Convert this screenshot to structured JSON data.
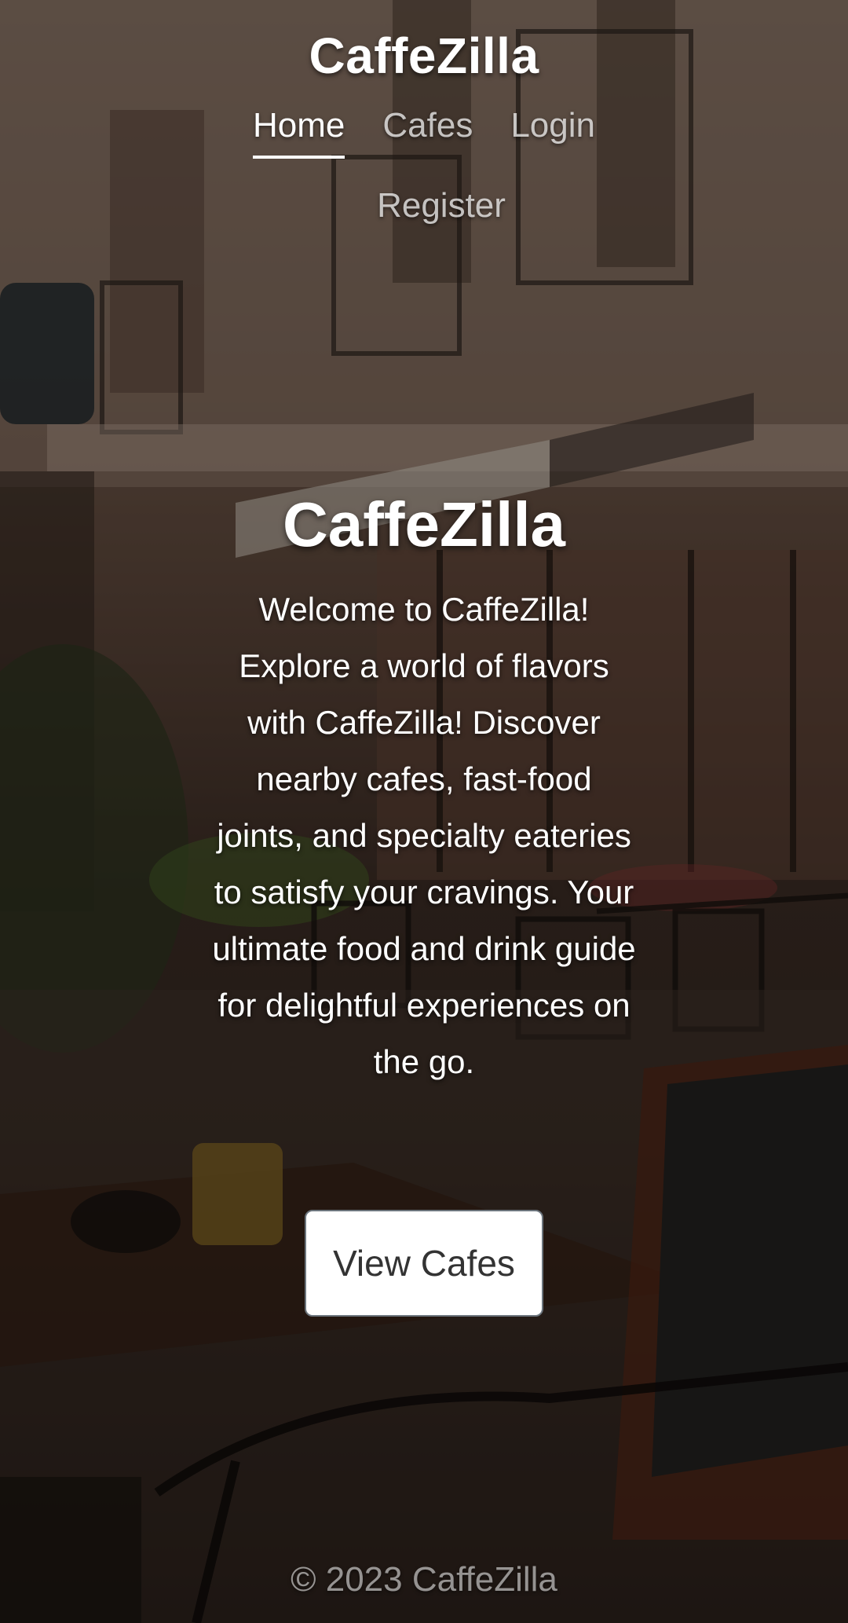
{
  "header": {
    "brand": "CaffeZilla",
    "nav": [
      {
        "label": "Home",
        "active": true
      },
      {
        "label": "Cafes",
        "active": false
      },
      {
        "label": "Login",
        "active": false
      },
      {
        "label": "Register",
        "active": false
      }
    ]
  },
  "hero": {
    "title": "CaffeZilla",
    "lead": "Welcome to CaffeZilla! Explore a world of flavors with CaffeZilla! Discover nearby cafes, fast-food joints, and specialty eateries to satisfy your cravings. Your ultimate food and drink guide for delightful experiences on the go.",
    "cta_label": "View Cafes"
  },
  "footer": {
    "copyright": "© 2023 CaffeZilla"
  }
}
